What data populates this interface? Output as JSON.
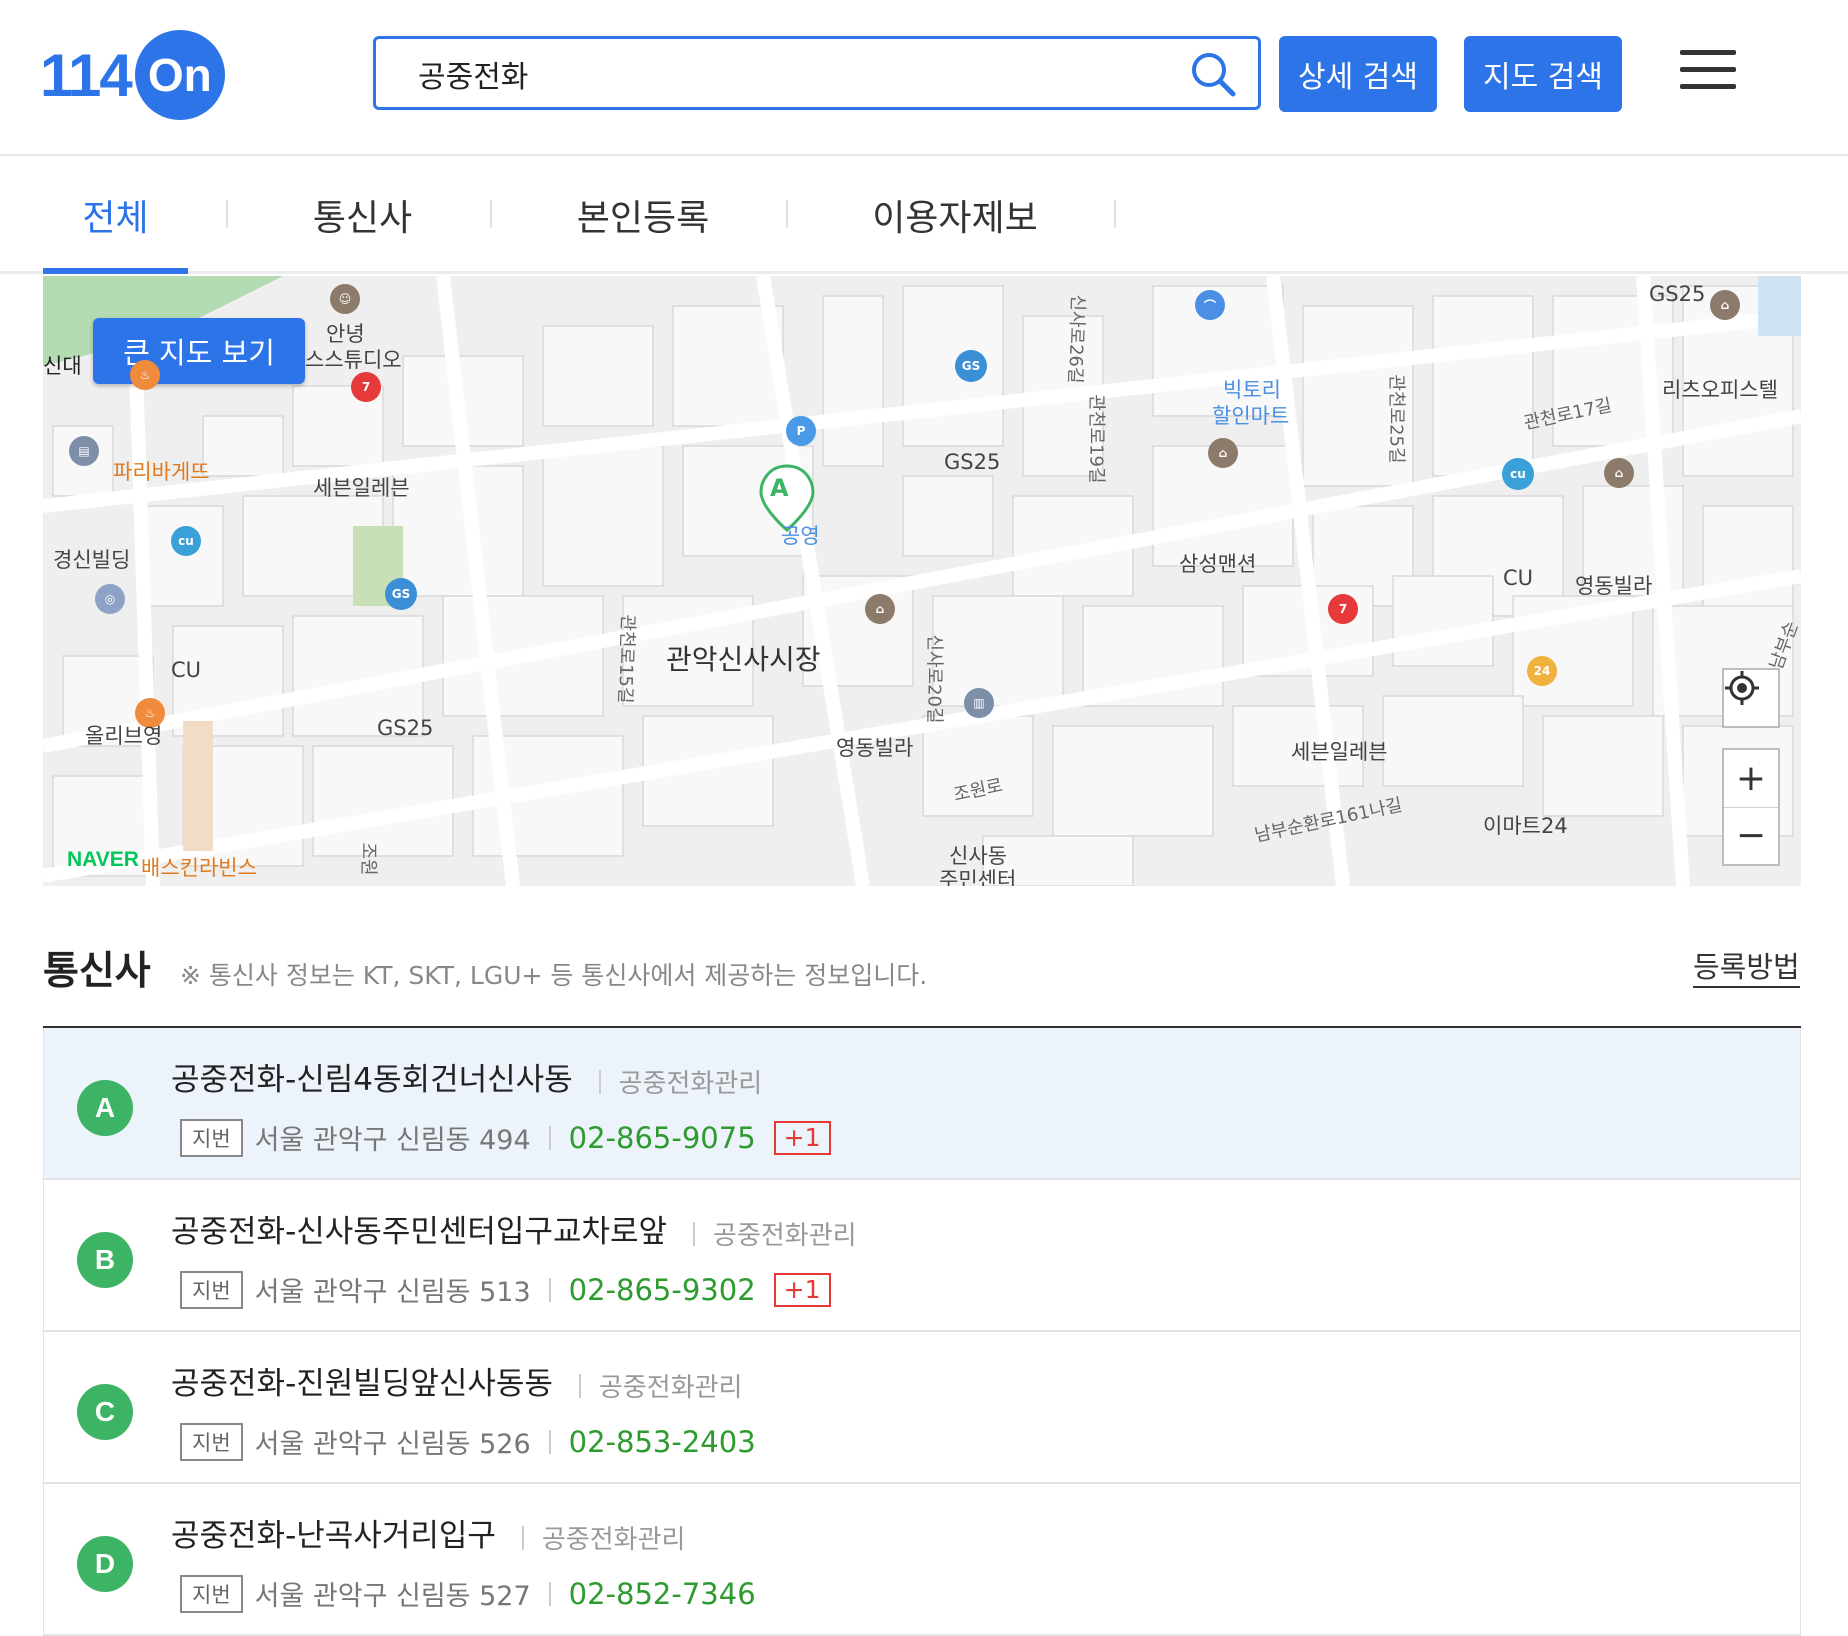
{
  "header": {
    "logo_num": "114",
    "logo_badge": "On",
    "search_value": "공중전화",
    "detail_search_label": "상세 검색",
    "map_search_label": "지도 검색"
  },
  "tabs": [
    {
      "label": "전체",
      "active": true
    },
    {
      "label": "통신사",
      "active": false
    },
    {
      "label": "본인등록",
      "active": false
    },
    {
      "label": "이용자제보",
      "active": false
    }
  ],
  "map": {
    "big_map_button": "큰 지도 보기",
    "zoom_in": "+",
    "zoom_out": "−",
    "provider_logo": "NAVER",
    "labels": {
      "annyeong_studio_1": "안녕",
      "annyeong_studio_2": "스스튜디오",
      "sindae": "신대",
      "paris": "파리바게뜨",
      "seven1": "세븐일레븐",
      "gyeongsin": "경신빌딩",
      "cu1": "CU",
      "oliveyoung": "올리브영",
      "gs25_a": "GS25",
      "gs25_b": "GS25",
      "gs25_c": "GS25",
      "gongyeong": "공영",
      "market": "관악신사시장",
      "yeongdong1": "영동빌라",
      "yeongdong2": "영동빌라",
      "victory1": "빅토리",
      "victory2": "할인마트",
      "samsung": "삼성맨션",
      "cu2": "CU",
      "ritz": "리츠오피스텔",
      "seven2": "세븐일레븐",
      "emart24": "이마트24",
      "sinsa_center1": "신사동",
      "sinsa_center2": "주민센터",
      "baskin": "배스킨라빈스",
      "road_sinsa26": "신사로26길",
      "road_gwancheon19": "관천로19길",
      "road_gwancheon25": "관천로25길",
      "road_gwancheon17": "관천로17길",
      "road_gwancheon15": "관천로15길",
      "road_sinsa20": "신사로20길",
      "road_jowon": "조원로",
      "road_nambu": "남부순환로161나길",
      "road_jowon2": "조원",
      "road_nambu2": "남부순",
      "pin_a": "A"
    }
  },
  "section": {
    "title": "통신사",
    "note": "※ 통신사 정보는 KT, SKT, LGU+ 등 통신사에서 제공하는 정보입니다.",
    "register_link": "등록방법"
  },
  "listings": [
    {
      "marker": "A",
      "name": "공중전화-신림4동회건너신사동",
      "category": "공중전화관리",
      "tag": "지번",
      "address": "서울 관악구 신림동 494",
      "phone": "02-865-9075",
      "extra": "+1",
      "selected": true
    },
    {
      "marker": "B",
      "name": "공중전화-신사동주민센터입구교차로앞",
      "category": "공중전화관리",
      "tag": "지번",
      "address": "서울 관악구 신림동 513",
      "phone": "02-865-9302",
      "extra": "+1",
      "selected": false
    },
    {
      "marker": "C",
      "name": "공중전화-진원빌딩앞신사동동",
      "category": "공중전화관리",
      "tag": "지번",
      "address": "서울 관악구 신림동 526",
      "phone": "02-853-2403",
      "extra": "",
      "selected": false
    },
    {
      "marker": "D",
      "name": "공중전화-난곡사거리입구",
      "category": "공중전화관리",
      "tag": "지번",
      "address": "서울 관악구 신림동 527",
      "phone": "02-852-7346",
      "extra": "",
      "selected": false
    }
  ],
  "colors": {
    "accent": "#2d74e8",
    "marker_green": "#3db465",
    "phone_green": "#2e9b2e",
    "badge_red": "#e53935",
    "selected_row": "#ecf3fb"
  }
}
